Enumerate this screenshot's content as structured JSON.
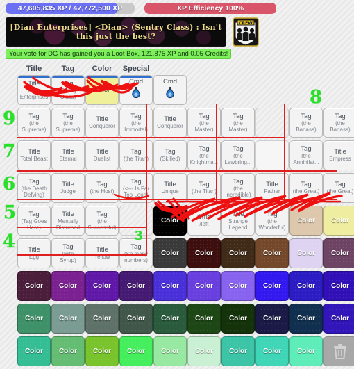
{
  "xp_bar": {
    "text": "47,605,835 XP / 47,772,500 XP",
    "fill_percent": 87,
    "fill_color": "#6c70f5",
    "track_color": "#c9c9c9"
  },
  "efficiency_bar": {
    "text": "XP Efficiency 100%",
    "color": "#d9556a"
  },
  "chat": {
    "message": "[Dian Enterprises]  <Dian>  (Sentry Class) : Isn't this just the best?",
    "badge_label": "CREW"
  },
  "vote_banner": {
    "text": "Your vote for DG has gained you a Loot Box, 121,875 XP and 0.05 Credits!",
    "color": "#7ef05b"
  },
  "column_headers": [
    "Title",
    "Tag",
    "Color",
    "Special"
  ],
  "annotations": {
    "row_numbers": [
      "9",
      "7",
      "6",
      "5",
      "4"
    ],
    "marker_8": "8",
    "marker_3": "3"
  },
  "grid": {
    "rows": [
      {
        "id": "row-inventory-equipped",
        "cells": [
          {
            "kind": "item",
            "line1": "Title",
            "line2": "Dian Enterprises",
            "equipped": true,
            "scribbled": true
          },
          {
            "kind": "item",
            "line1": "Tag",
            "line2": "(Sentry Class)",
            "equipped": true,
            "scribbled": true
          },
          {
            "kind": "item",
            "line1": "Color",
            "line2": "",
            "equipped": true,
            "scribbled": true,
            "swatch": "#f0ef9a"
          },
          {
            "kind": "item",
            "line1": "Cmd",
            "line2": "",
            "equipped": true,
            "scribbled": true,
            "icon": "potion-icon"
          },
          {
            "kind": "item",
            "line1": "Cmd",
            "line2": "",
            "equipped": false,
            "icon": "potion-icon"
          }
        ]
      },
      {
        "id": "row-9",
        "cells": [
          {
            "kind": "item",
            "line1": "Tag",
            "line2": "(the Supreme)"
          },
          {
            "kind": "item",
            "line1": "Tag",
            "line2": "(the Supreme)"
          },
          {
            "kind": "item",
            "line1": "Title",
            "line2": "Conqueror"
          },
          {
            "kind": "item",
            "line1": "Tag",
            "line2": "(the Immortal)"
          },
          {
            "kind": "item",
            "line1": "Title",
            "line2": "Conqueror"
          },
          {
            "kind": "item",
            "line1": "Tag",
            "line2": "(the Master)"
          },
          {
            "kind": "item",
            "line1": "Tag",
            "line2": "(the Master)"
          },
          {
            "kind": "empty"
          },
          {
            "kind": "item",
            "line1": "Tag",
            "line2": "(the Badass)"
          },
          {
            "kind": "item",
            "line1": "Tag",
            "line2": "(the Badass)"
          }
        ]
      },
      {
        "id": "row-7",
        "cells": [
          {
            "kind": "item",
            "line1": "Title",
            "line2": "Total Beast"
          },
          {
            "kind": "item",
            "line1": "Title",
            "line2": "Eternal"
          },
          {
            "kind": "item",
            "line1": "Title",
            "line2": "Duelist"
          },
          {
            "kind": "item",
            "line1": "Tag",
            "line2": "(the Titan)"
          },
          {
            "kind": "item",
            "line1": "Tag",
            "line2": "(Skilled)"
          },
          {
            "kind": "item",
            "line1": "Tag",
            "line2": "(the Knightma..."
          },
          {
            "kind": "item",
            "line1": "Tag",
            "line2": "(the Lawbring..."
          },
          {
            "kind": "blank"
          },
          {
            "kind": "item",
            "line1": "Tag",
            "line2": "(the Annihilat..."
          },
          {
            "kind": "item",
            "line1": "Title",
            "line2": "Empress"
          }
        ]
      },
      {
        "id": "row-6",
        "cells": [
          {
            "kind": "item",
            "line1": "Tag",
            "line2": "(the Death Defying)"
          },
          {
            "kind": "item",
            "line1": "Title",
            "line2": "Judge"
          },
          {
            "kind": "item",
            "line1": "Tag",
            "line2": "(the Host)"
          },
          {
            "kind": "item",
            "line1": "Tag",
            "line2": "(<--- Is Far Too Loud)"
          },
          {
            "kind": "item",
            "line1": "Title",
            "line2": "Unique"
          },
          {
            "kind": "item",
            "line1": "Tag",
            "line2": "(the Titan)"
          },
          {
            "kind": "item",
            "line1": "Tag",
            "line2": "(the Incredible)"
          },
          {
            "kind": "item",
            "line1": "Title",
            "line2": "Father"
          },
          {
            "kind": "item",
            "line1": "Tag",
            "line2": "(the Great)"
          },
          {
            "kind": "item",
            "line1": "Tag",
            "line2": "(the Great)"
          }
        ]
      },
      {
        "id": "row-5",
        "cells": [
          {
            "kind": "item",
            "line1": "Tag",
            "line2": "(Tag Goes Here)"
          },
          {
            "kind": "item",
            "line1": "Title",
            "line2": "Mentally Disturbed"
          },
          {
            "kind": "item",
            "line1": "Tag",
            "line2": "(the Successful)"
          },
          {
            "kind": "empty"
          },
          {
            "kind": "color",
            "label": "Color",
            "swatch": "#000000",
            "scribbled": true
          },
          {
            "kind": "item",
            "line1": "Cmd",
            "line2": "/left"
          },
          {
            "kind": "item",
            "line1": "Title",
            "line2": "Strange Legend",
            "scribbled": true
          },
          {
            "kind": "item",
            "line1": "Tag",
            "line2": "(the Wonderful)",
            "scribbled": true
          },
          {
            "kind": "color",
            "label": "Color",
            "swatch": "#ddc8ae",
            "scribbled": true
          },
          {
            "kind": "color",
            "label": "Color",
            "swatch": "#efeda0",
            "scribbled": true
          }
        ]
      },
      {
        "id": "row-4",
        "cells": [
          {
            "kind": "item",
            "line1": "Title",
            "line2": "Egg"
          },
          {
            "kind": "item",
            "line1": "Tag",
            "line2": "(with Syrup)"
          },
          {
            "kind": "item",
            "line1": "Title",
            "line2": "Yellow"
          },
          {
            "kind": "item",
            "line1": "Tag",
            "line2": "(So many numbers)"
          },
          {
            "kind": "color",
            "label": "Color",
            "swatch": "#3a3a3a"
          },
          {
            "kind": "color",
            "label": "Color",
            "swatch": "#3d0f0f"
          },
          {
            "kind": "color",
            "label": "Color",
            "swatch": "#402b18"
          },
          {
            "kind": "color",
            "label": "Color",
            "swatch": "#74492b"
          },
          {
            "kind": "color",
            "label": "Color",
            "swatch": "#ded4f2"
          },
          {
            "kind": "color",
            "label": "Color",
            "swatch": "#6e4464"
          }
        ]
      },
      {
        "id": "row-colors-purple",
        "cells": [
          {
            "kind": "color",
            "label": "Color",
            "swatch": "#4b1f3c"
          },
          {
            "kind": "color",
            "label": "Color",
            "swatch": "#7c2191"
          },
          {
            "kind": "color",
            "label": "Color",
            "swatch": "#5f18a8"
          },
          {
            "kind": "color",
            "label": "Color",
            "swatch": "#451a72"
          },
          {
            "kind": "color",
            "label": "Color",
            "swatch": "#4930d8"
          },
          {
            "kind": "color",
            "label": "Color",
            "swatch": "#6a3fe0"
          },
          {
            "kind": "color",
            "label": "Color",
            "swatch": "#8763ef"
          },
          {
            "kind": "color",
            "label": "Color",
            "swatch": "#3318f0"
          },
          {
            "kind": "color",
            "label": "Color",
            "swatch": "#2b1cc4"
          },
          {
            "kind": "color",
            "label": "Color",
            "swatch": "#3111b7"
          }
        ]
      },
      {
        "id": "row-colors-green-dark",
        "cells": [
          {
            "kind": "color",
            "label": "Color",
            "swatch": "#3e9168"
          },
          {
            "kind": "color",
            "label": "Color",
            "swatch": "#7a9c92"
          },
          {
            "kind": "color",
            "label": "Color",
            "swatch": "#5f7269"
          },
          {
            "kind": "color",
            "label": "Color",
            "swatch": "#41574a"
          },
          {
            "kind": "color",
            "label": "Color",
            "swatch": "#2a5b3c"
          },
          {
            "kind": "color",
            "label": "Color",
            "swatch": "#1d4715"
          },
          {
            "kind": "color",
            "label": "Color",
            "swatch": "#15330b"
          },
          {
            "kind": "color",
            "label": "Color",
            "swatch": "#1b1a47"
          },
          {
            "kind": "color",
            "label": "Color",
            "swatch": "#11304f"
          },
          {
            "kind": "color",
            "label": "Color",
            "swatch": "#3316ba"
          }
        ]
      },
      {
        "id": "row-colors-green-light",
        "cells": [
          {
            "kind": "color",
            "label": "Color",
            "swatch": "#35bd94"
          },
          {
            "kind": "color",
            "label": "Color",
            "swatch": "#64bd72"
          },
          {
            "kind": "color",
            "label": "Color",
            "swatch": "#79c42c"
          },
          {
            "kind": "color",
            "label": "Color",
            "swatch": "#45ee5c"
          },
          {
            "kind": "color",
            "label": "Color",
            "swatch": "#97e8a0"
          },
          {
            "kind": "color",
            "label": "Color",
            "swatch": "#c9f0d2"
          },
          {
            "kind": "color",
            "label": "Color",
            "swatch": "#3cc4a6"
          },
          {
            "kind": "color",
            "label": "Color",
            "swatch": "#3ed6b6"
          },
          {
            "kind": "color",
            "label": "Color",
            "swatch": "#5eedb9"
          },
          {
            "kind": "trash",
            "label": "trash-icon"
          }
        ]
      }
    ]
  }
}
